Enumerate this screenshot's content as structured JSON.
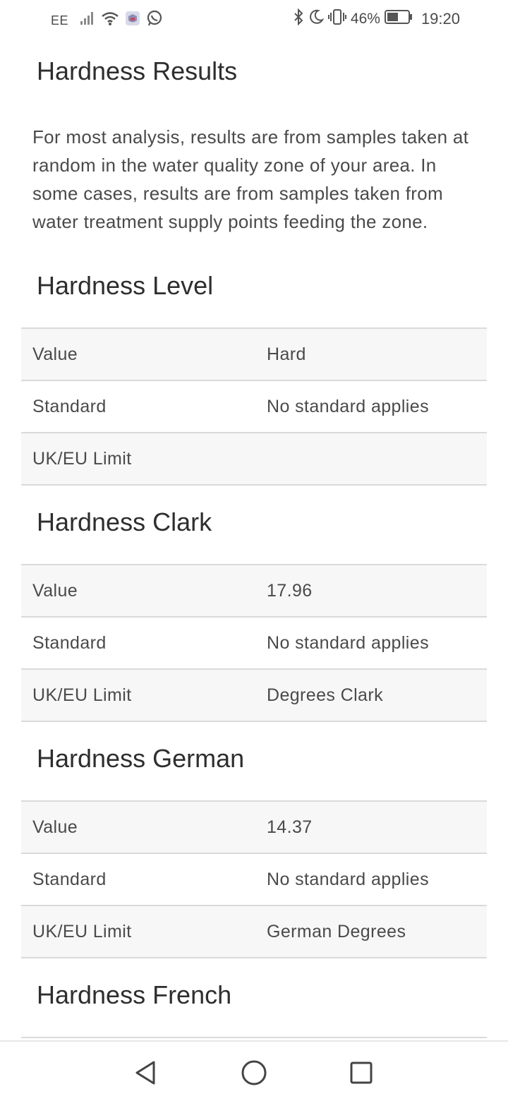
{
  "status_bar": {
    "carrier": "EE",
    "battery_percent": "46%",
    "time": "19:20"
  },
  "page": {
    "title": "Hardness Results",
    "intro": "For most analysis, results are from samples taken at random in the water quality zone of your area. In some cases, results are from samples taken from water treatment supply points feeding the zone."
  },
  "sections": [
    {
      "title": "Hardness Level",
      "rows": [
        {
          "label": "Value",
          "value": "Hard"
        },
        {
          "label": "Standard",
          "value": "No standard applies"
        },
        {
          "label": "UK/EU Limit",
          "value": ""
        }
      ]
    },
    {
      "title": "Hardness Clark",
      "rows": [
        {
          "label": "Value",
          "value": "17.96"
        },
        {
          "label": "Standard",
          "value": "No standard applies"
        },
        {
          "label": "UK/EU Limit",
          "value": "Degrees Clark"
        }
      ]
    },
    {
      "title": "Hardness German",
      "rows": [
        {
          "label": "Value",
          "value": "14.37"
        },
        {
          "label": "Standard",
          "value": "No standard applies"
        },
        {
          "label": "UK/EU Limit",
          "value": "German Degrees"
        }
      ]
    },
    {
      "title": "Hardness French",
      "rows": []
    }
  ],
  "icons": [
    "signal-icon",
    "wifi-icon",
    "app-notification-icon",
    "whatsapp-icon",
    "bluetooth-icon",
    "do-not-disturb-icon",
    "vibrate-icon",
    "battery-icon",
    "back-icon",
    "home-icon",
    "recents-icon"
  ]
}
